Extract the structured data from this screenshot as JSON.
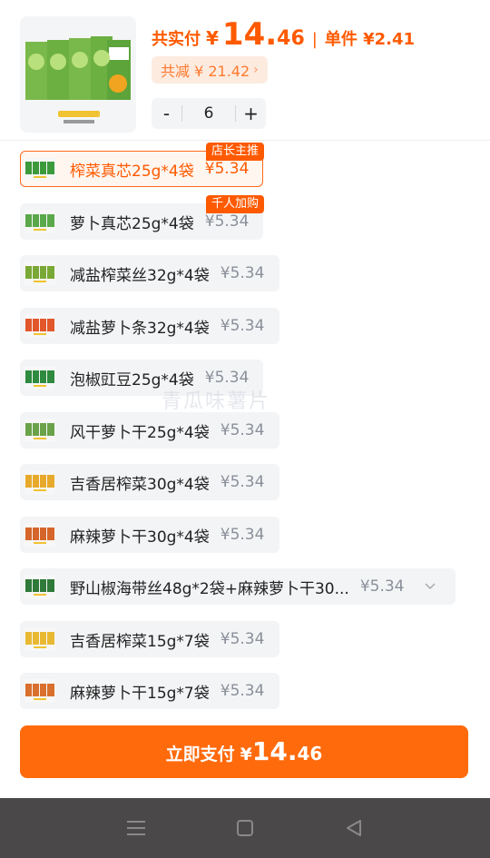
{
  "header": {
    "total_label": "共实付",
    "currency": "¥",
    "total_int": "14.",
    "total_dec": "46",
    "separator": "|",
    "unit_label": "单件 ¥2.41",
    "discount_label": "共减 ¥ 21.42",
    "discount_chevron": "chevron-right-icon",
    "product_image": "zhacai-heart-pack-image"
  },
  "stepper": {
    "minus": "-",
    "quantity": "6",
    "plus": "+"
  },
  "options": [
    {
      "name": "榨菜真芯25g*4袋",
      "price": "¥5.34",
      "badge": "店长主推",
      "selected": true,
      "thumb_color": "#3c9a3c"
    },
    {
      "name": "萝卜真芯25g*4袋",
      "price": "¥5.34",
      "badge": "千人加购",
      "selected": false,
      "thumb_color": "#5aa84a"
    },
    {
      "name": "减盐榨菜丝32g*4袋",
      "price": "¥5.34",
      "badge": "",
      "selected": false,
      "thumb_color": "#7aa836"
    },
    {
      "name": "减盐萝卜条32g*4袋",
      "price": "¥5.34",
      "badge": "",
      "selected": false,
      "thumb_color": "#e2572b"
    },
    {
      "name": "泡椒豇豆25g*4袋",
      "price": "¥5.34",
      "badge": "",
      "selected": false,
      "thumb_color": "#2e8a3e"
    },
    {
      "name": "风干萝卜干25g*4袋",
      "price": "¥5.34",
      "badge": "",
      "selected": false,
      "thumb_color": "#6aa24a"
    },
    {
      "name": "吉香居榨菜30g*4袋",
      "price": "¥5.34",
      "badge": "",
      "selected": false,
      "thumb_color": "#e7a92c"
    },
    {
      "name": "麻辣萝卜干30g*4袋",
      "price": "¥5.34",
      "badge": "",
      "selected": false,
      "thumb_color": "#d5652a"
    },
    {
      "name": "野山椒海带丝48g*2袋+麻辣萝卜干30...",
      "price": "¥5.34",
      "badge": "",
      "selected": false,
      "thumb_color": "#2f7a3a",
      "has_caret": true
    },
    {
      "name": "吉香居榨菜15g*7袋",
      "price": "¥5.34",
      "badge": "",
      "selected": false,
      "thumb_color": "#e9b934"
    },
    {
      "name": "麻辣萝卜干15g*7袋",
      "price": "¥5.34",
      "badge": "",
      "selected": false,
      "thumb_color": "#d9702d"
    }
  ],
  "pay_button": {
    "label": "立即支付",
    "currency": "¥",
    "amount_int": "14.",
    "amount_dec": "46"
  },
  "navbar": {
    "menu": "menu-icon",
    "home": "home-square-icon",
    "back": "back-triangle-icon"
  },
  "watermark": "青瓜味薯片"
}
